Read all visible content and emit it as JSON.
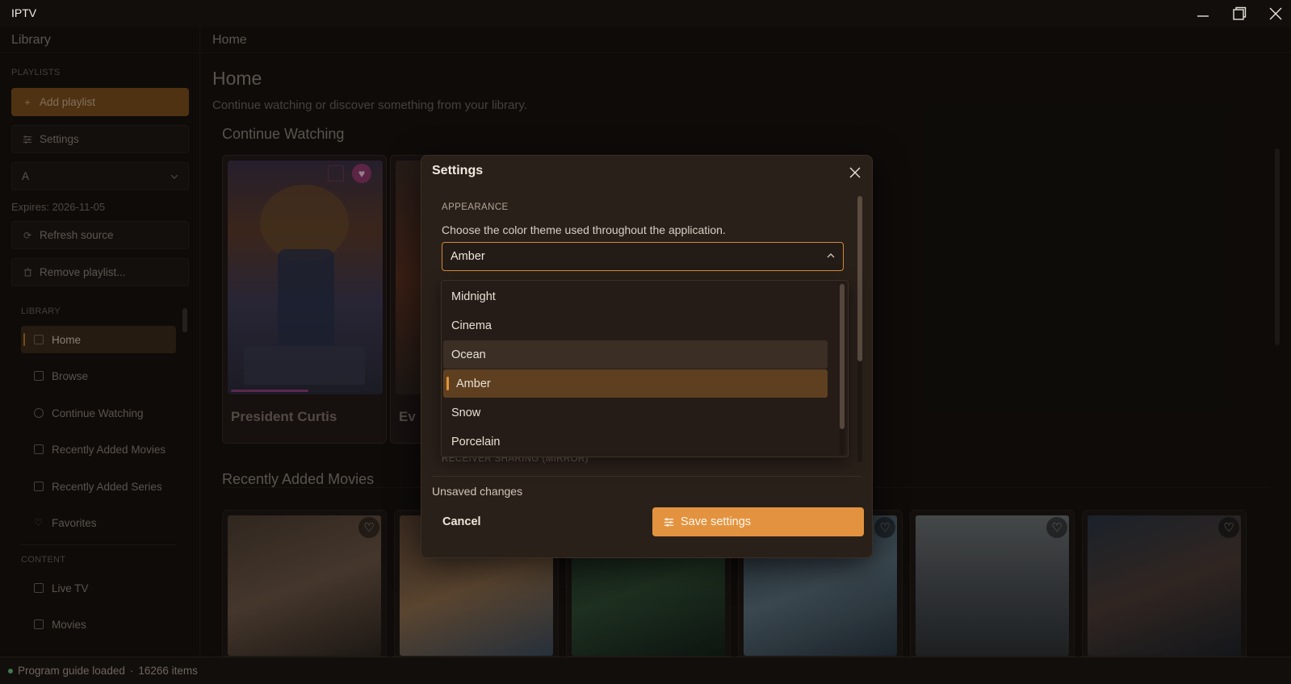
{
  "window": {
    "title": "IPTV"
  },
  "sidebar": {
    "header": "Library",
    "playlists_label": "PLAYLISTS",
    "add_playlist": "Add playlist",
    "settings": "Settings",
    "playlist_select": "A",
    "expires": "Expires: 2026-11-05",
    "refresh": "Refresh source",
    "remove": "Remove playlist...",
    "library_label": "LIBRARY",
    "library_items": [
      "Home",
      "Browse",
      "Continue Watching",
      "Recently Added Movies",
      "Recently Added Series",
      "Favorites"
    ],
    "content_label": "CONTENT",
    "content_items": [
      "Live TV",
      "Movies"
    ]
  },
  "main": {
    "breadcrumb": "Home",
    "title": "Home",
    "subtitle": "Continue watching or discover something from your library.",
    "continue_watching": {
      "title": "Continue Watching",
      "items": [
        {
          "name": "President Curtis",
          "progress": 0.5
        },
        {
          "name": "Ev"
        }
      ]
    },
    "recently_added_movies": {
      "title": "Recently Added Movies"
    }
  },
  "dialog": {
    "title": "Settings",
    "section_label": "APPEARANCE",
    "section_desc": "Choose the color theme used throughout the application.",
    "theme_value": "Amber",
    "theme_options": [
      "Midnight",
      "Cinema",
      "Ocean",
      "Amber",
      "Snow",
      "Porcelain"
    ],
    "hovered_option": "Ocean",
    "ghost_text": "RECEIVER SHARING (MIRROR)",
    "unsaved": "Unsaved changes",
    "cancel": "Cancel",
    "save": "Save settings"
  },
  "status": {
    "text": "Program guide loaded",
    "separator": "·",
    "count": "16266 items"
  },
  "colors": {
    "accent": "#e3933f",
    "background": "#181310",
    "dialog": "#2a201a"
  }
}
